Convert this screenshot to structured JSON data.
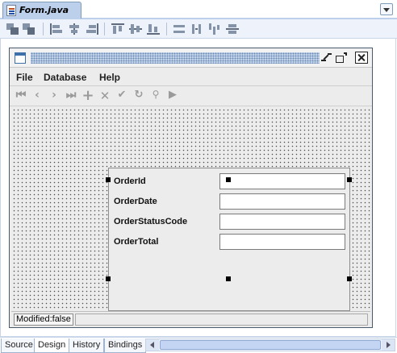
{
  "editor": {
    "tab_title": "Form.java",
    "tab_icon": "java-form-file-icon",
    "dropdown_icon": "chevron-down-icon"
  },
  "layout_toolbar": {
    "icons": [
      "selection-mode-icon",
      "connection-mode-icon",
      "align-left-icon",
      "align-center-icon",
      "align-right-icon",
      "align-top-icon",
      "align-middle-icon",
      "align-bottom-icon",
      "same-width-icon",
      "same-height-icon",
      "change-horizontal-resizability-icon",
      "change-vertical-resizability-icon"
    ]
  },
  "form": {
    "window_controls": [
      "minimize-icon",
      "maximize-icon",
      "close-icon"
    ],
    "menus": [
      {
        "label": "File"
      },
      {
        "label": "Database"
      },
      {
        "label": "Help"
      }
    ],
    "nav_toolbar": [
      "first-record-icon",
      "previous-record-icon",
      "next-record-icon",
      "last-record-icon",
      "add-record-icon",
      "delete-record-icon",
      "commit-icon",
      "refresh-icon",
      "find-icon",
      "run-icon"
    ],
    "fields": [
      {
        "label": "OrderId",
        "value": ""
      },
      {
        "label": "OrderDate",
        "value": ""
      },
      {
        "label": "OrderStatusCode",
        "value": ""
      },
      {
        "label": "OrderTotal",
        "value": ""
      }
    ],
    "status": "Modified:false"
  },
  "view_tabs": [
    {
      "label": "Source",
      "active": false
    },
    {
      "label": "Design",
      "active": true
    },
    {
      "label": "History",
      "active": false
    },
    {
      "label": "Bindings",
      "active": false
    }
  ],
  "colors": {
    "tab_active": "#bcd0ec",
    "toolbar_bg": "#eef3fb",
    "form_bg": "#ececec",
    "selection_handle": "#000000"
  }
}
